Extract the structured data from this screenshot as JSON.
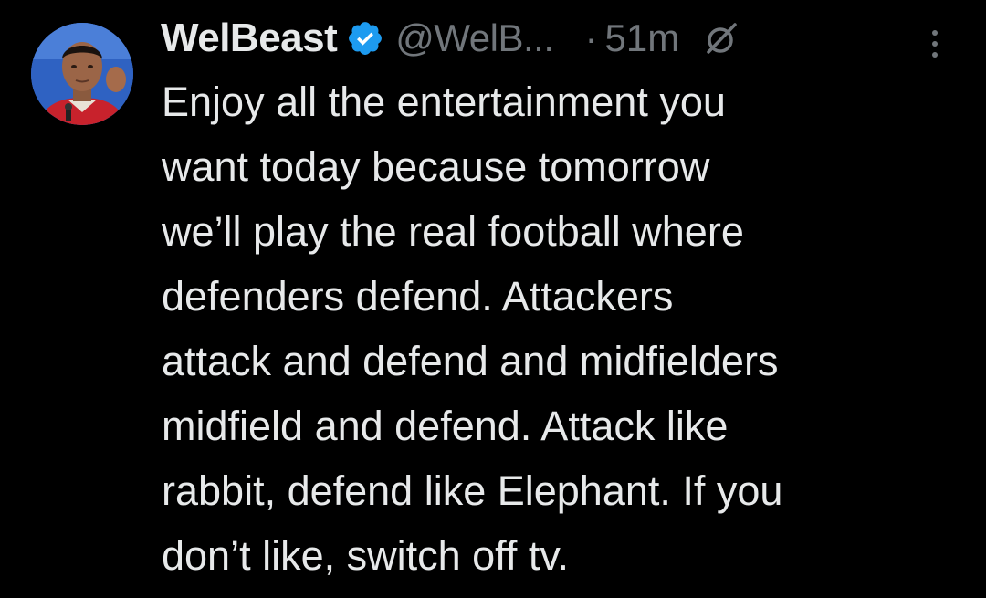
{
  "tweet": {
    "author": {
      "display_name": "WelBeast",
      "handle": "@WelB...",
      "verified": true,
      "avatar_icon": "user-avatar-photo"
    },
    "separator": "·",
    "time": "51m",
    "grok_icon": "grok-icon",
    "more_icon": "more-vertical-icon",
    "text_lines": [
      "Enjoy all the entertainment you",
      "want today because tomorrow",
      "we’ll play the real football where",
      "defenders defend. Attackers",
      "attack and defend and midfielders",
      "midfield and defend. Attack like",
      "rabbit, defend like Elephant. If you",
      "don’t like, switch off tv."
    ]
  },
  "colors": {
    "background": "#000000",
    "text_primary": "#e7e9ea",
    "text_secondary": "#71767b",
    "verified_blue": "#1d9bf0"
  }
}
